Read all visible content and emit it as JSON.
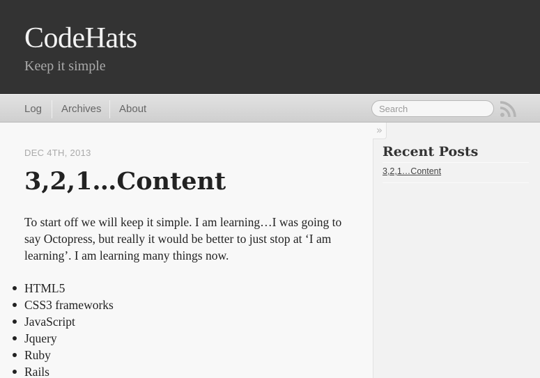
{
  "header": {
    "title": "CodeHats",
    "subtitle": "Keep it simple"
  },
  "nav": {
    "items": [
      {
        "label": "Log"
      },
      {
        "label": "Archives"
      },
      {
        "label": "About"
      }
    ],
    "search_placeholder": "Search",
    "rss_icon": "rss-icon"
  },
  "post": {
    "date": "DEC 4TH, 2013",
    "title": "3,2,1…Content",
    "paragraph": "To start off we will keep it simple. I am learning…I was going to say Octopress, but really it would be better to just stop at ‘I am learning’. I am learning many things now.",
    "list": [
      "HTML5",
      "CSS3 frameworks",
      "JavaScript",
      "Jquery",
      "Ruby",
      "Rails"
    ]
  },
  "sidebar": {
    "toggle": "»",
    "recent_title": "Recent Posts",
    "recent_posts": [
      "3,2,1…Content"
    ]
  },
  "colors": {
    "header_bg": "#333333",
    "title_color": "#f2f2f2",
    "subtitle_color": "#aaaaaa",
    "rss_color": "#b5b5b5"
  }
}
